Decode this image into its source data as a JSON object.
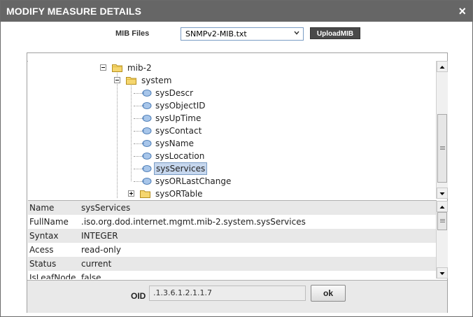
{
  "dialog": {
    "title": "MODIFY MEASURE DETAILS",
    "close_glyph": "×"
  },
  "mib": {
    "label": "MIB Files",
    "selected": "SNMPv2-MIB.txt",
    "upload_label": "UploadMIB"
  },
  "tree": {
    "nodes": [
      {
        "label": "mib-2",
        "type": "folder",
        "expanded": true
      },
      {
        "label": "system",
        "type": "folder",
        "expanded": true
      },
      {
        "label": "sysDescr",
        "type": "leaf"
      },
      {
        "label": "sysObjectID",
        "type": "leaf"
      },
      {
        "label": "sysUpTime",
        "type": "leaf"
      },
      {
        "label": "sysContact",
        "type": "leaf"
      },
      {
        "label": "sysName",
        "type": "leaf"
      },
      {
        "label": "sysLocation",
        "type": "leaf"
      },
      {
        "label": "sysServices",
        "type": "leaf",
        "selected": true
      },
      {
        "label": "sysORLastChange",
        "type": "leaf"
      },
      {
        "label": "sysORTable",
        "type": "folder",
        "expanded": false
      }
    ]
  },
  "properties": {
    "rows": [
      {
        "key": "Name",
        "value": "sysServices"
      },
      {
        "key": "FullName",
        "value": ".iso.org.dod.internet.mgmt.mib-2.system.sysServices"
      },
      {
        "key": "Syntax",
        "value": "INTEGER"
      },
      {
        "key": "Acess",
        "value": "read-only"
      },
      {
        "key": "Status",
        "value": "current"
      },
      {
        "key": "IsLeafNode",
        "value": "false"
      }
    ]
  },
  "oid": {
    "label": "OID",
    "value": ".1.3.6.1.2.1.1.7",
    "ok_label": "ok"
  },
  "colors": {
    "titlebar": "#666666",
    "selection": "#c6d7ee",
    "folder": "#f5d66e",
    "leaf_icon": "#7fa8d8"
  }
}
